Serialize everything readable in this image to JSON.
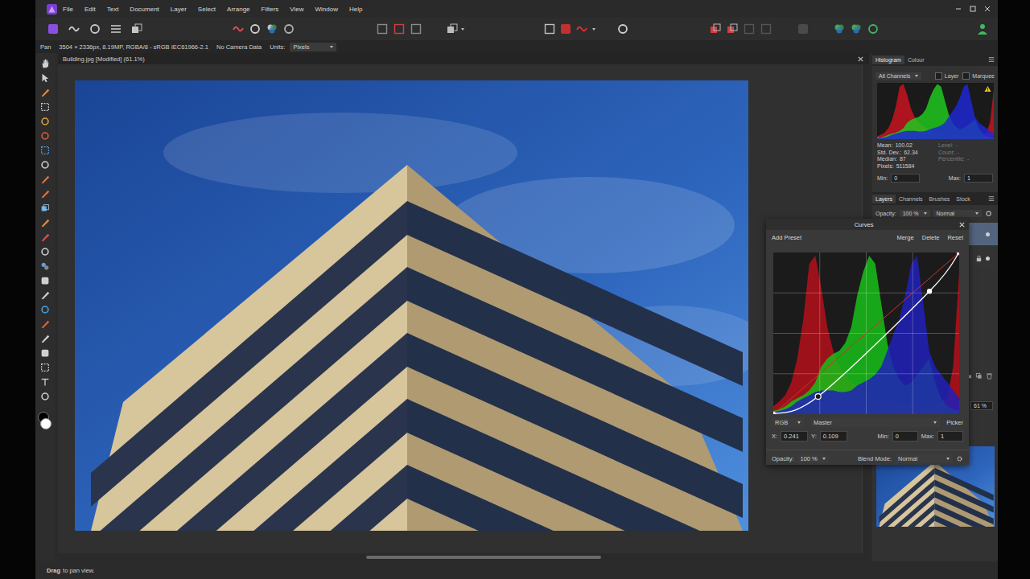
{
  "menu": [
    "File",
    "Edit",
    "Text",
    "Document",
    "Layer",
    "Select",
    "Arrange",
    "Filters",
    "View",
    "Window",
    "Help"
  ],
  "context_bar": {
    "tool": "Pan",
    "info": "3504 × 2336px, 8.19MP, RGBA/8 - sRGB IEC61966-2.1",
    "camera": "No Camera Data",
    "units_label": "Units:",
    "units": "Pixels"
  },
  "document": {
    "tab": "Building.jpg [Modified] (61.1%)"
  },
  "status_bar": {
    "action": "Drag",
    "hint": "to pan view."
  },
  "histogram_panel": {
    "tabs": [
      {
        "label": "Histogram",
        "selected": true
      },
      {
        "label": "Colour",
        "selected": false
      }
    ],
    "channel": "All Channels",
    "options": [
      {
        "label": "Layer",
        "checked": false
      },
      {
        "label": "Marquee",
        "checked": false
      }
    ],
    "warning": true,
    "series": [
      {
        "color": "#c8141e",
        "values": [
          0.05,
          0.08,
          0.12,
          0.2,
          0.35,
          0.6,
          0.95,
          1.0,
          0.8,
          0.55,
          0.4,
          0.3,
          0.25,
          0.2,
          0.18,
          0.15,
          0.12,
          0.1,
          0.1,
          0.08,
          0.08,
          0.07,
          0.06,
          0.06,
          0.05,
          0.05,
          0.05,
          0.06,
          0.08,
          0.1,
          0.3,
          0.9
        ]
      },
      {
        "color": "#1ec81e",
        "values": [
          0.02,
          0.03,
          0.05,
          0.08,
          0.1,
          0.12,
          0.15,
          0.2,
          0.3,
          0.35,
          0.38,
          0.4,
          0.45,
          0.55,
          0.75,
          0.9,
          1.0,
          0.95,
          0.7,
          0.45,
          0.3,
          0.22,
          0.18,
          0.2,
          0.25,
          0.3,
          0.35,
          0.2,
          0.1,
          0.05,
          0.03,
          0.02
        ]
      },
      {
        "color": "#1e28d2",
        "values": [
          0.01,
          0.02,
          0.03,
          0.05,
          0.08,
          0.1,
          0.12,
          0.14,
          0.15,
          0.15,
          0.15,
          0.14,
          0.14,
          0.15,
          0.18,
          0.2,
          0.22,
          0.25,
          0.3,
          0.4,
          0.5,
          0.6,
          0.75,
          0.95,
          1.0,
          0.7,
          0.4,
          0.3,
          0.25,
          0.2,
          0.15,
          0.1
        ]
      }
    ],
    "stats": [
      {
        "label": "Mean:",
        "value": "100.02"
      },
      {
        "label": "Std. Dev.:",
        "value": "62.34"
      },
      {
        "label": "Median:",
        "value": "87"
      },
      {
        "label": "Pixels:",
        "value": "511584"
      }
    ],
    "cursor_stats": [
      {
        "label": "Level:",
        "value": "-"
      },
      {
        "label": "Count:",
        "value": "-"
      },
      {
        "label": "Percentile:",
        "value": "-"
      }
    ],
    "min_label": "Min:",
    "min": "0",
    "max_label": "Max:",
    "max": "1"
  },
  "layers_panel": {
    "tabs": [
      {
        "label": "Layers",
        "selected": true
      },
      {
        "label": "Channels",
        "selected": false
      },
      {
        "label": "Brushes",
        "selected": false
      },
      {
        "label": "Stock",
        "selected": false
      }
    ],
    "opacity_label": "Opacity:",
    "opacity": "100 %",
    "blend": "Normal",
    "layers": [
      {
        "selected": true,
        "locked": false
      },
      {
        "selected": false,
        "locked": true
      }
    ],
    "zoom": "61 %"
  },
  "curves": {
    "title": "Curves",
    "preset": "Add Preset",
    "actions": [
      "Merge",
      "Delete",
      "Reset"
    ],
    "channel": "RGB",
    "mode": "Master",
    "picker": "Picker",
    "x_label": "X:",
    "x": "0.241",
    "y_label": "Y:",
    "y": "0.109",
    "min_label": "Min:",
    "min": "0",
    "max_label": "Max:",
    "max": "1",
    "opacity_label": "Opacity:",
    "opacity": "100 %",
    "blend_label": "Blend Mode:",
    "blend": "Normal",
    "points": [
      {
        "x": 0,
        "y": 0,
        "selected": false
      },
      {
        "x": 0.241,
        "y": 0.109,
        "selected": true
      },
      {
        "x": 0.84,
        "y": 0.76,
        "selected": false
      },
      {
        "x": 1,
        "y": 1,
        "selected": false
      }
    ],
    "series": [
      {
        "color": "#b4101a",
        "values": [
          0.05,
          0.08,
          0.12,
          0.2,
          0.35,
          0.6,
          0.95,
          1.0,
          0.8,
          0.55,
          0.4,
          0.3,
          0.25,
          0.2,
          0.18,
          0.15,
          0.12,
          0.1,
          0.1,
          0.08,
          0.08,
          0.07,
          0.06,
          0.06,
          0.05,
          0.05,
          0.05,
          0.06,
          0.08,
          0.1,
          0.3,
          0.9
        ]
      },
      {
        "color": "#18c018",
        "values": [
          0.02,
          0.03,
          0.05,
          0.08,
          0.1,
          0.12,
          0.15,
          0.2,
          0.3,
          0.35,
          0.38,
          0.4,
          0.45,
          0.55,
          0.75,
          0.9,
          1.0,
          0.95,
          0.7,
          0.45,
          0.3,
          0.22,
          0.18,
          0.2,
          0.25,
          0.3,
          0.35,
          0.2,
          0.1,
          0.05,
          0.03,
          0.02
        ]
      },
      {
        "color": "#2020b8",
        "values": [
          0.01,
          0.02,
          0.03,
          0.05,
          0.08,
          0.1,
          0.12,
          0.14,
          0.15,
          0.15,
          0.15,
          0.14,
          0.14,
          0.15,
          0.18,
          0.2,
          0.22,
          0.25,
          0.3,
          0.4,
          0.5,
          0.6,
          0.75,
          0.95,
          1.0,
          0.7,
          0.4,
          0.3,
          0.25,
          0.2,
          0.15,
          0.1
        ]
      }
    ]
  }
}
